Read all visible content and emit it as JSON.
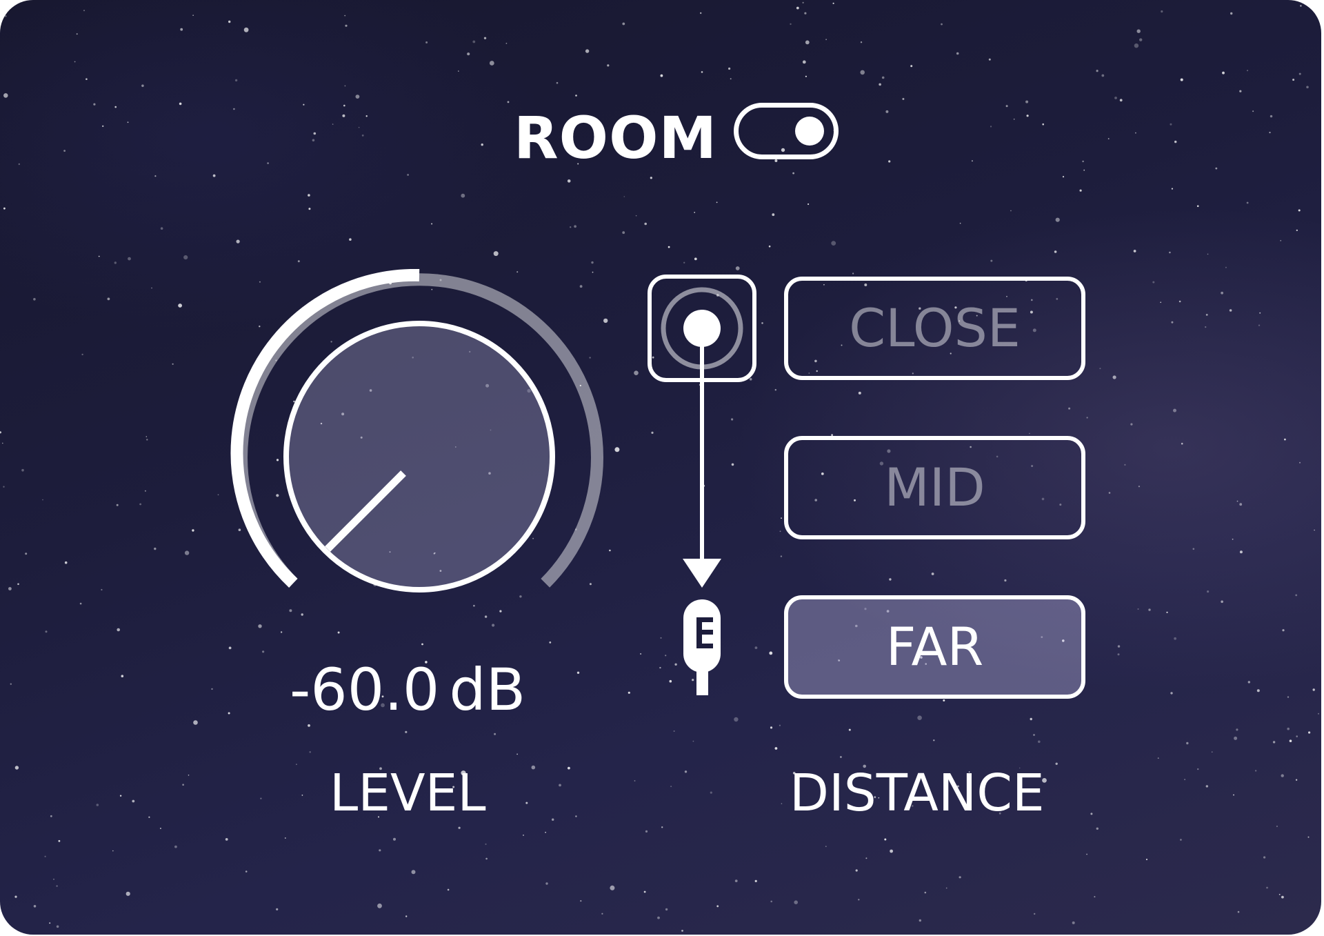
{
  "room": {
    "label": "ROOM",
    "enabled": true
  },
  "level": {
    "value": "-60.0",
    "unit": "dB",
    "label": "LEVEL"
  },
  "distance": {
    "label": "DISTANCE",
    "options": [
      "CLOSE",
      "MID",
      "FAR"
    ],
    "selected": "FAR"
  },
  "icons": {
    "toggle": "toggle-switch-icon",
    "source": "sound-source-icon",
    "arrow": "arrow-down-icon",
    "mic": "microphone-icon"
  },
  "colors": {
    "background": "#1d1d3c",
    "foreground": "#ffffff",
    "inactive_text": "rgba(255,255,255,0.45)",
    "selected_fill": "rgba(190,185,225,0.38)"
  }
}
